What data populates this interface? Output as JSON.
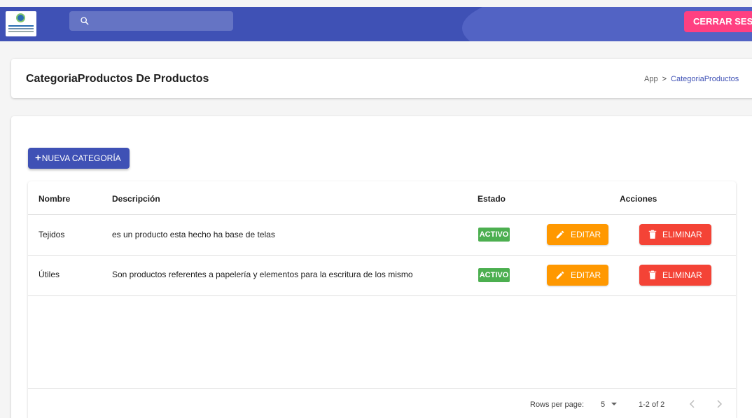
{
  "topbar": {
    "search_placeholder": "",
    "logout_label": "CERRAR SESIÓN"
  },
  "header": {
    "title": "CategoriaProductos De Productos",
    "breadcrumb": {
      "root": "App",
      "current": "CategoriaProductos"
    }
  },
  "toolbar": {
    "new_label": "NUEVA CATEGORÍA"
  },
  "table": {
    "columns": {
      "name": "Nombre",
      "description": "Descripción",
      "status": "Estado",
      "actions": "Acciones"
    },
    "rows": [
      {
        "name": "Tejidos",
        "description": "es un producto esta hecho ha base de telas",
        "status": "ACTIVO",
        "edit": "EDITAR",
        "delete": "ELIMINAR"
      },
      {
        "name": "Útiles",
        "description": "Son productos referentes a papelería y elementos para la escritura de los mismo",
        "status": "ACTIVO",
        "edit": "EDITAR",
        "delete": "ELIMINAR"
      }
    ],
    "footer": {
      "rows_per_page_label": "Rows per page:",
      "rows_per_page_value": "5",
      "range": "1-2 of 2"
    }
  },
  "colors": {
    "primary": "#3f51b5",
    "accent": "#ff4081",
    "success": "#4caf50",
    "warning": "#ff9800",
    "error": "#f44336"
  },
  "icons": [
    "search-icon",
    "plus-icon",
    "pencil-icon",
    "trash-icon",
    "caret-down-icon",
    "chevron-left-icon",
    "chevron-right-icon"
  ]
}
